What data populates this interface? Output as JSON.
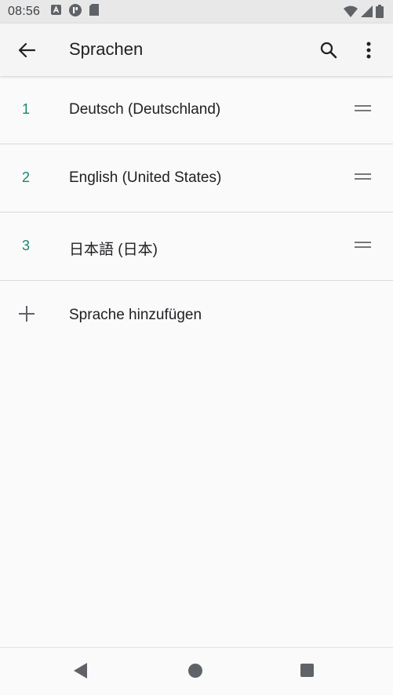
{
  "status_bar": {
    "time": "08:56",
    "left_icons": [
      "font-a-icon",
      "app-circle-icon",
      "sd-card-icon"
    ],
    "right_icons": [
      "wifi-icon",
      "signal-icon",
      "battery-icon"
    ]
  },
  "app_bar": {
    "title": "Sprachen",
    "back_icon": "arrow-left-icon",
    "search_icon": "search-icon",
    "more_icon": "more-vert-icon"
  },
  "languages": [
    {
      "number": "1",
      "label": "Deutsch (Deutschland)"
    },
    {
      "number": "2",
      "label": "English (United States)"
    },
    {
      "number": "3",
      "label": "日本語 (日本)"
    }
  ],
  "add_language": {
    "label": "Sprache hinzufügen"
  },
  "colors": {
    "accent": "#198774",
    "background": "#fafafa",
    "app_bar": "#f5f5f5"
  }
}
